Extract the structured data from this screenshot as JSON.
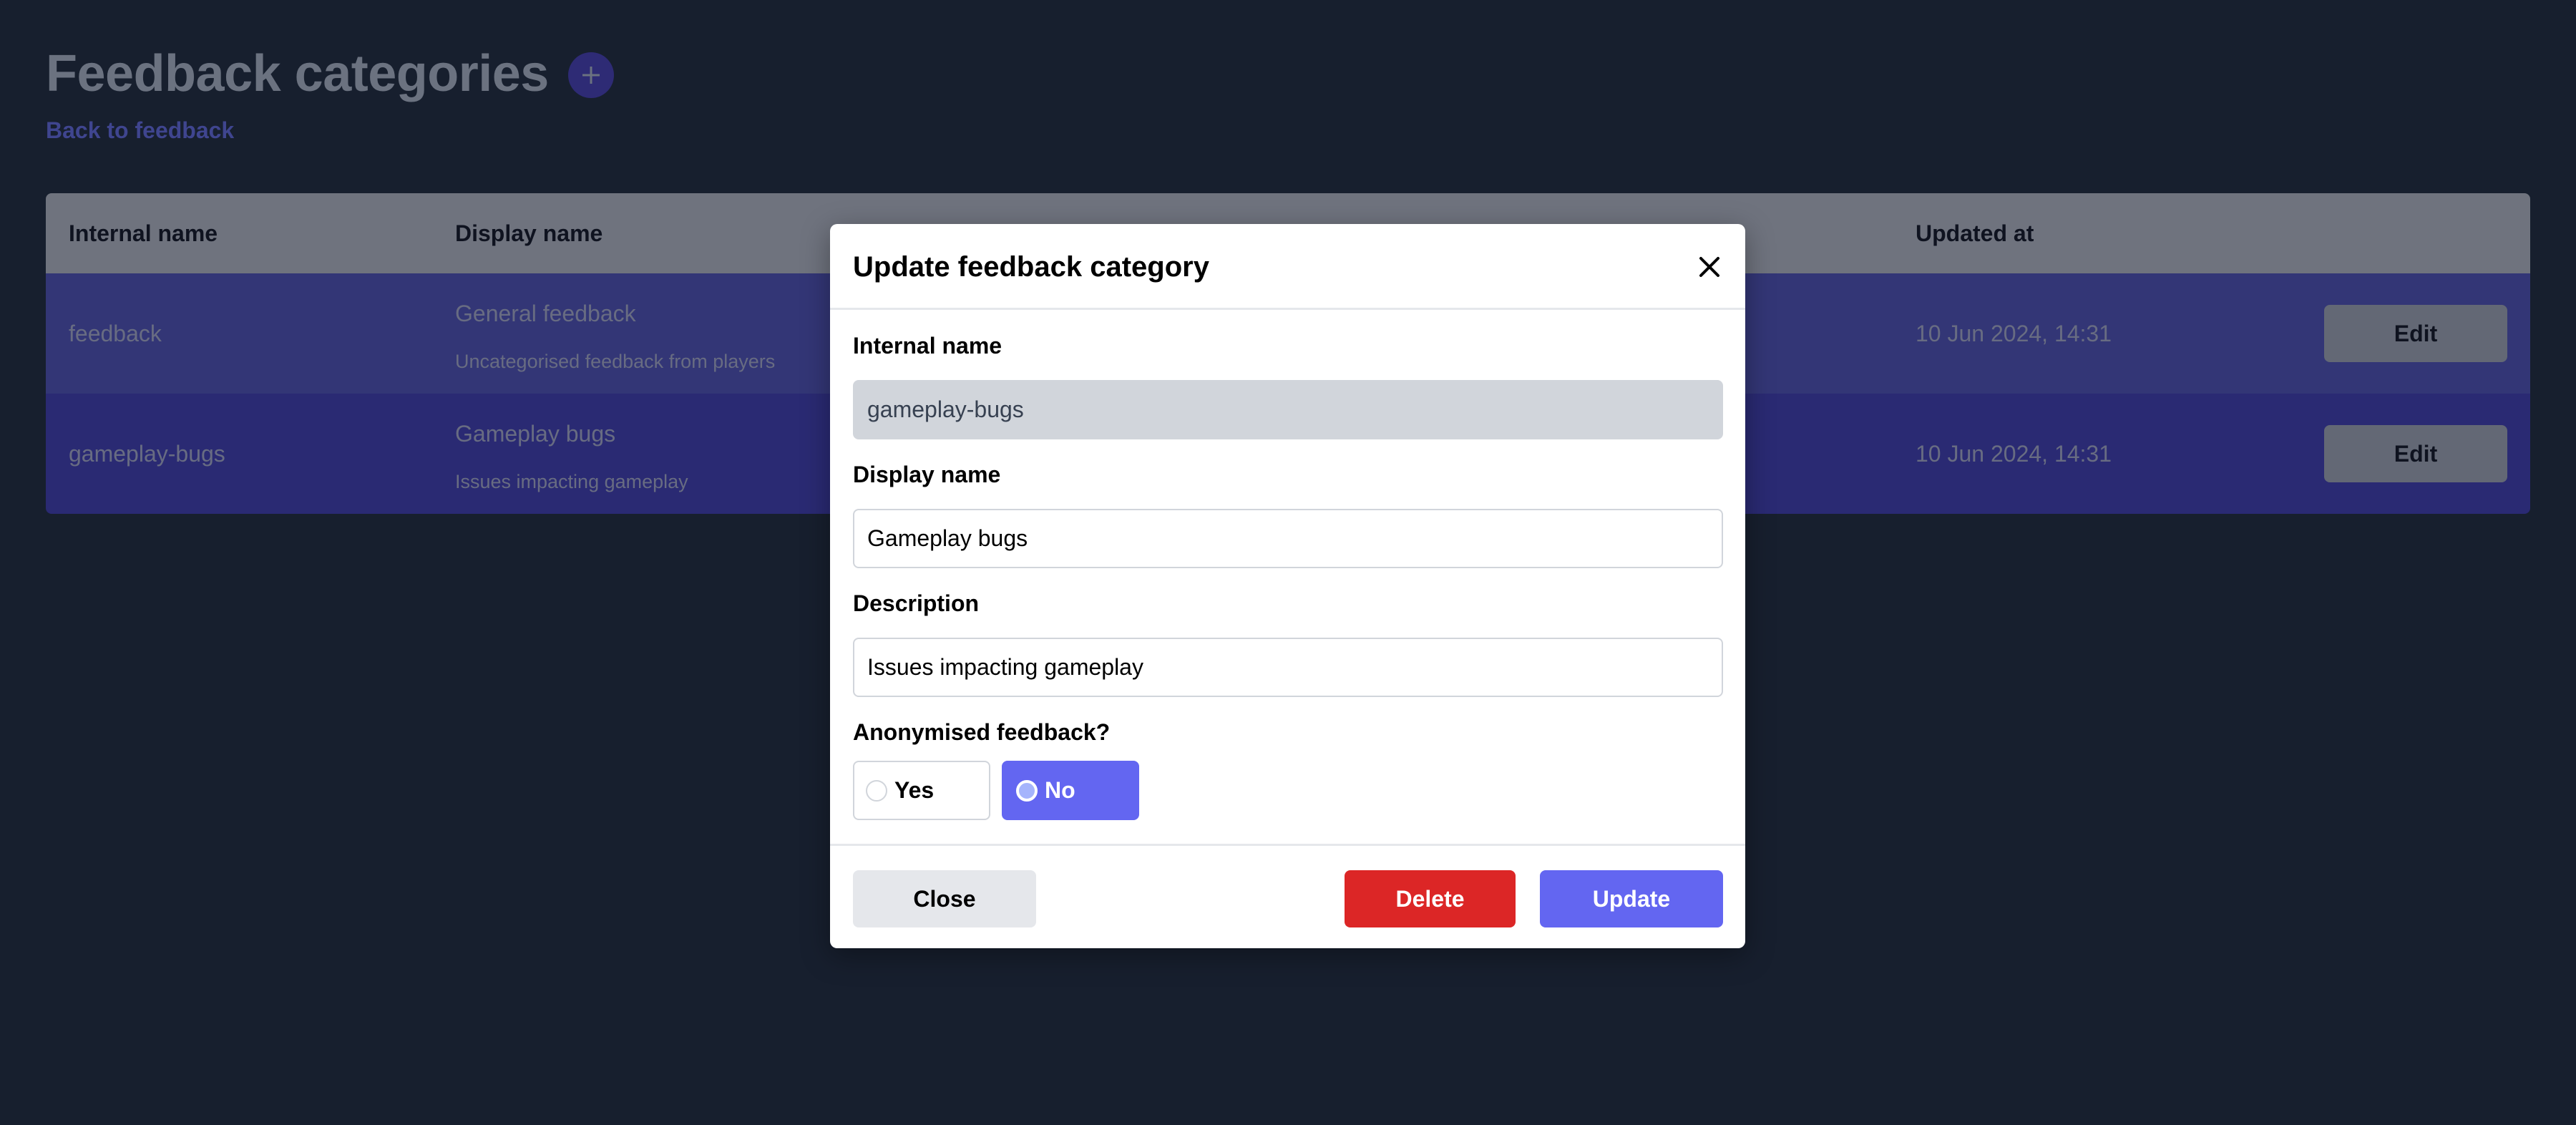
{
  "header": {
    "title": "Feedback categories",
    "add_icon": "plus-icon",
    "back_link": "Back to feedback"
  },
  "table": {
    "columns": [
      "Internal name",
      "Display name",
      "Updated at"
    ],
    "rows": [
      {
        "internal_name": "feedback",
        "display_name": "General feedback",
        "description": "Uncategorised feedback from players",
        "updated_at": "10 Jun 2024, 14:31",
        "action": "Edit"
      },
      {
        "internal_name": "gameplay-bugs",
        "display_name": "Gameplay bugs",
        "description": "Issues impacting gameplay",
        "updated_at": "10 Jun 2024, 14:31",
        "action": "Edit"
      }
    ]
  },
  "modal": {
    "title": "Update feedback category",
    "close_icon": "close-icon",
    "fields": {
      "internal_name": {
        "label": "Internal name",
        "value": "gameplay-bugs",
        "disabled": true
      },
      "display_name": {
        "label": "Display name",
        "value": "Gameplay bugs"
      },
      "description": {
        "label": "Description",
        "value": "Issues impacting gameplay"
      }
    },
    "anonymised": {
      "label": "Anonymised feedback?",
      "options": [
        "Yes",
        "No"
      ],
      "selected": "No"
    },
    "buttons": {
      "close": "Close",
      "delete": "Delete",
      "update": "Update"
    }
  },
  "colors": {
    "background": "#171f2e",
    "accent": "#6366f1",
    "danger": "#dc2626",
    "row_alt_1": "#333676",
    "row_alt_2": "#2a2a73"
  }
}
